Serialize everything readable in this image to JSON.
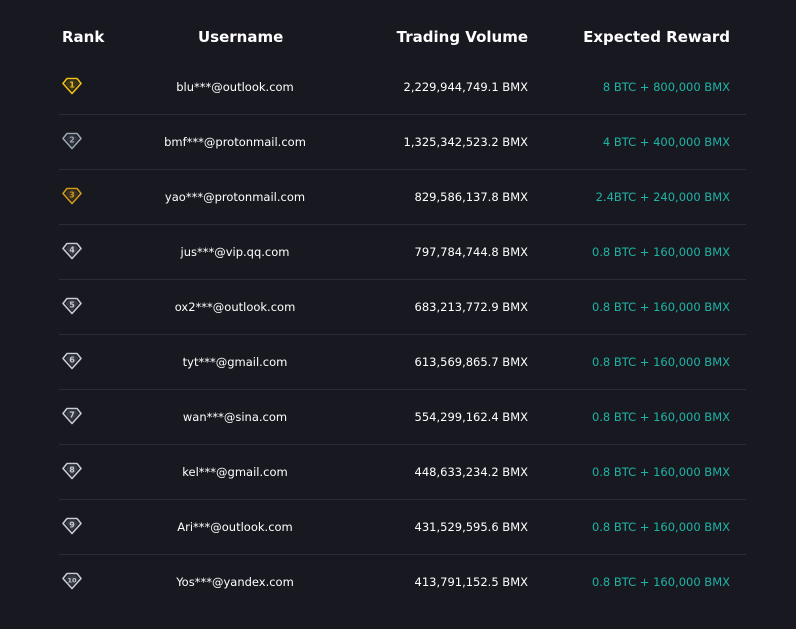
{
  "header": {
    "rank": "Rank",
    "username": "Username",
    "volume": "Trading Volume",
    "reward": "Expected Reward"
  },
  "colors": {
    "background": "#181920",
    "reward_text": "#1fb3a6",
    "gold": "#f2c012",
    "silver": "#9aa7b2",
    "bronze": "#d29a1b",
    "default_badge": "#c8cbd3"
  },
  "rows": [
    {
      "rank": "1",
      "badge": "gold-diamond-icon",
      "username": "blu***@outlook.com",
      "volume": "2,229,944,749.1 BMX",
      "reward": "8 BTC + 800,000 BMX"
    },
    {
      "rank": "2",
      "badge": "silver-diamond-icon",
      "username": "bmf***@protonmail.com",
      "volume": "1,325,342,523.2 BMX",
      "reward": "4 BTC + 400,000 BMX"
    },
    {
      "rank": "3",
      "badge": "bronze-diamond-icon",
      "username": "yao***@protonmail.com",
      "volume": "829,586,137.8 BMX",
      "reward": "2.4BTC + 240,000 BMX"
    },
    {
      "rank": "4",
      "badge": "diamond-icon",
      "username": "jus***@vip.qq.com",
      "volume": "797,784,744.8 BMX",
      "reward": "0.8 BTC + 160,000 BMX"
    },
    {
      "rank": "5",
      "badge": "diamond-icon",
      "username": "ox2***@outlook.com",
      "volume": "683,213,772.9 BMX",
      "reward": "0.8 BTC + 160,000 BMX"
    },
    {
      "rank": "6",
      "badge": "diamond-icon",
      "username": "tyt***@gmail.com",
      "volume": "613,569,865.7 BMX",
      "reward": "0.8 BTC + 160,000 BMX"
    },
    {
      "rank": "7",
      "badge": "diamond-icon",
      "username": "wan***@sina.com",
      "volume": "554,299,162.4 BMX",
      "reward": "0.8 BTC + 160,000 BMX"
    },
    {
      "rank": "8",
      "badge": "diamond-icon",
      "username": "kel***@gmail.com",
      "volume": "448,633,234.2 BMX",
      "reward": "0.8 BTC + 160,000 BMX"
    },
    {
      "rank": "9",
      "badge": "diamond-icon",
      "username": "Ari***@outlook.com",
      "volume": "431,529,595.6 BMX",
      "reward": "0.8 BTC + 160,000 BMX"
    },
    {
      "rank": "10",
      "badge": "diamond-icon",
      "username": "Yos***@yandex.com",
      "volume": "413,791,152.5 BMX",
      "reward": "0.8 BTC + 160,000 BMX"
    }
  ]
}
